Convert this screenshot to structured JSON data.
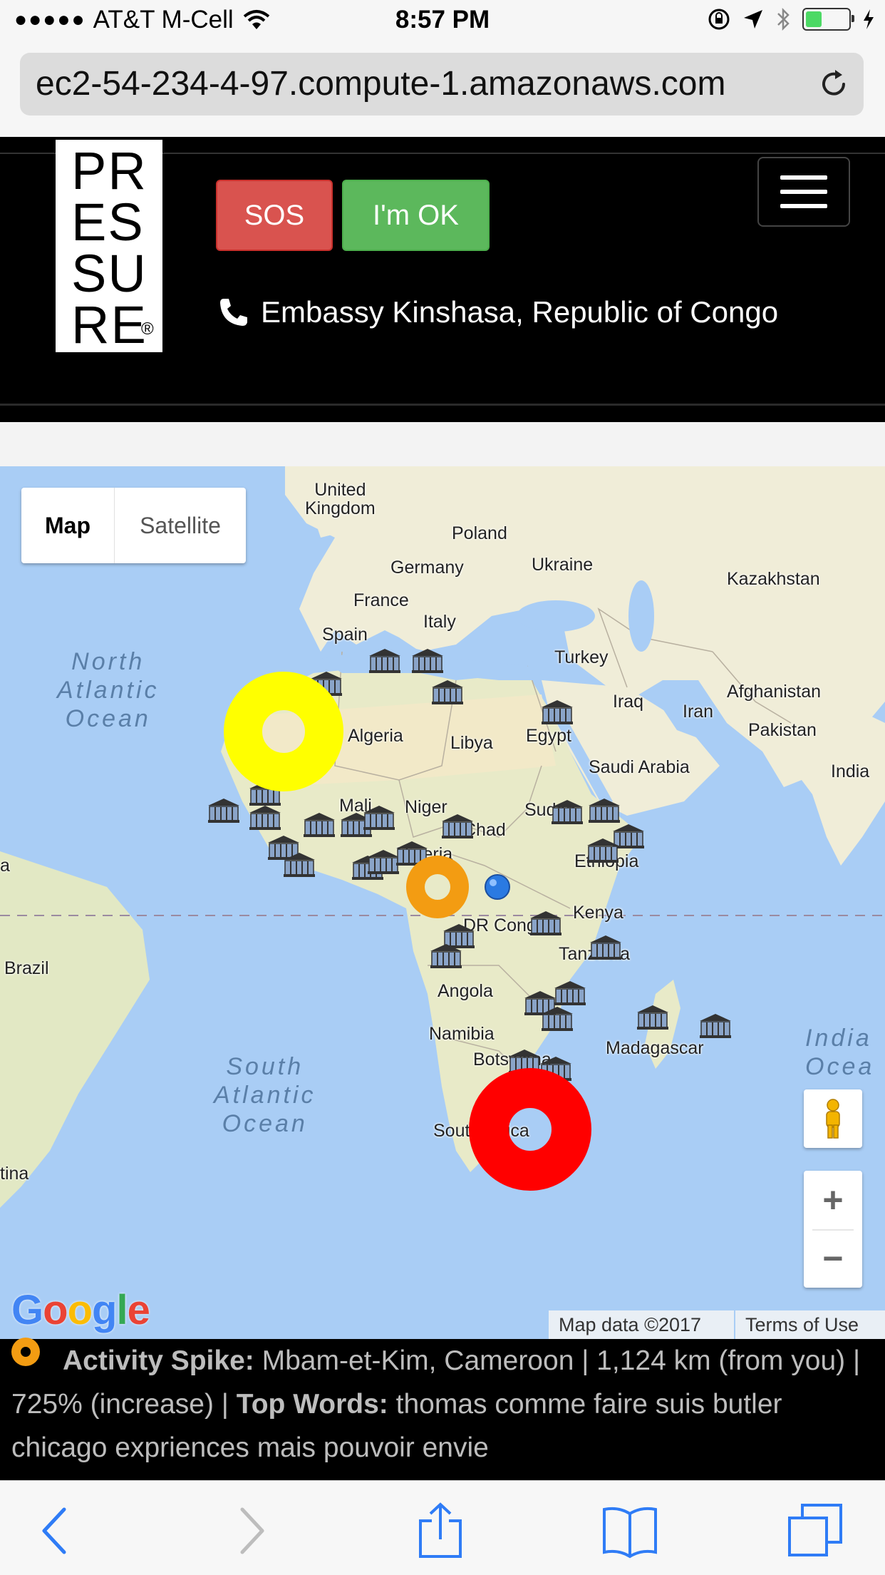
{
  "status_bar": {
    "signal_dots": "●●●●●",
    "carrier": "AT&T M-Cell",
    "time": "8:57 PM",
    "battery_level": 0.34
  },
  "browser": {
    "url": "ec2-54-234-4-97.compute-1.amazonaws.com"
  },
  "header": {
    "logo_text": "PR\nES\nSU\nRE",
    "logo_reg": "®",
    "sos_label": "SOS",
    "ok_label": "I'm OK",
    "embassy": "Embassy Kinshasa, Republic of Congo"
  },
  "map": {
    "type_map": "Map",
    "type_satellite": "Satellite",
    "zoom_in": "+",
    "zoom_out": "−",
    "google": "Google",
    "map_data": "Map data ©2017",
    "terms": "Terms of Use",
    "oceans": {
      "north_atlantic": "North\nAtlantic\nOcean",
      "south_atlantic": "South\nAtlantic\nOcean",
      "indian": "India\nOcea"
    },
    "places": {
      "uk": "United\nKingdom",
      "poland": "Poland",
      "germany": "Germany",
      "ukraine": "Ukraine",
      "kazakhstan": "Kazakhstan",
      "france": "France",
      "italy": "Italy",
      "spain": "Spain",
      "turkey": "Turkey",
      "iraq": "Iraq",
      "afghanistan": "Afghanistan",
      "iran": "Iran",
      "pakistan": "Pakistan",
      "algeria": "Algeria",
      "libya": "Libya",
      "egypt": "Egypt",
      "saudi": "Saudi Arabia",
      "india": "India",
      "mali": "Mali",
      "niger": "Niger",
      "sudan": "Sudan",
      "chad": "Chad",
      "nigeria": "Nigeria",
      "ethiopia": "Ethiopia",
      "kenya": "Kenya",
      "drcongo": "DR Congo",
      "tanzania": "Tanzania",
      "brazil": "Brazil",
      "angola": "Angola",
      "namibia": "Namibia",
      "madagascar": "Madagascar",
      "botswana": "Botswana",
      "south_africa": "South Africa",
      "argentina": "tina",
      "a_edge": "a"
    }
  },
  "info": {
    "spike_label": "Activity Spike:",
    "spike_text": " Mbam-et-Kim, Cameroon | 1,124 km (from you) | 725% (increase) | ",
    "words_label": "Top Words:",
    "words_text": " thomas comme faire suis butler chicago expriences mais pouvoir envie"
  },
  "colors": {
    "sos": "#d9534f",
    "ok": "#5cb85c",
    "marker_yellow": "#ffff00",
    "marker_orange": "#f39c12",
    "marker_red": "#ff0000",
    "land": "#f0edd8",
    "water": "#a9cdf5"
  },
  "icons": [
    "wifi-icon",
    "lock-rotation-icon",
    "location-arrow-icon",
    "bluetooth-icon",
    "battery-icon",
    "reload-icon",
    "phone-icon",
    "pegman-icon",
    "embassy-icon",
    "back-icon",
    "forward-icon",
    "share-icon",
    "bookmarks-icon",
    "tabs-icon"
  ]
}
